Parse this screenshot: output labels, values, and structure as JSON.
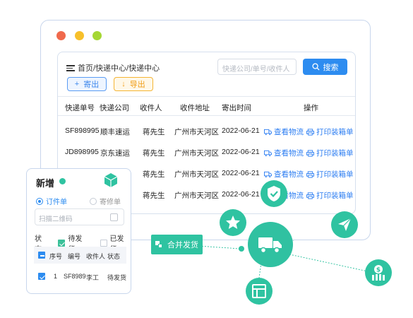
{
  "window": {
    "breadcrumb": "首页/快递中心/快递中心",
    "search_placeholder": "快递公司/单号/收件人",
    "search_label": "搜索",
    "out_label": "寄出",
    "out_icon": "plus-icon",
    "export_label": "导出",
    "export_icon": "download-icon",
    "columns": [
      "快递单号",
      "快递公司",
      "收件人",
      "收件地址",
      "寄出时间",
      "操作"
    ],
    "rows": [
      {
        "no": "SF898995",
        "company": "顺丰速运",
        "recipient": "蒋先生",
        "address": "广州市天河区",
        "time": "2022-06-21",
        "action1": "查看物流",
        "action2": "打印装箱单"
      },
      {
        "no": "JD898995",
        "company": "京东速运",
        "recipient": "蒋先生",
        "address": "广州市天河区",
        "time": "2022-06-21",
        "action1": "查看物流",
        "action2": "打印装箱单"
      },
      {
        "no": "",
        "company": "",
        "recipient": "蒋先生",
        "address": "广州市天河区",
        "time": "2022-06-21",
        "action1": "查看物流",
        "action2": "打印装箱单"
      },
      {
        "no": "",
        "company": "",
        "recipient": "蒋先生",
        "address": "广州市天河区",
        "time": "2022-06-21",
        "action1": "查看物流",
        "action2": "打印装箱单"
      }
    ]
  },
  "card": {
    "title": "新增",
    "radio_order": "订件单",
    "radio_repair": "寄修单",
    "scan_placeholder": "扫描二维码",
    "status_label": "状态：",
    "status_pending": "待发货",
    "status_shipped": "已发货",
    "mini_columns": [
      "序号",
      "编号",
      "收件人",
      "状态"
    ],
    "mini_row": {
      "index": "1",
      "code": "SF8989",
      "recipient": "李工",
      "status": "待发货"
    }
  },
  "merge_label": "合并发货",
  "nodes": [
    "truck-icon",
    "shield-check-icon",
    "star-icon",
    "paper-plane-icon",
    "money-bag-icon",
    "layout-icon",
    "box-icon"
  ],
  "colors": {
    "accent": "#2fc3a1",
    "primary": "#2d8cf0",
    "warning": "#f5b534"
  }
}
